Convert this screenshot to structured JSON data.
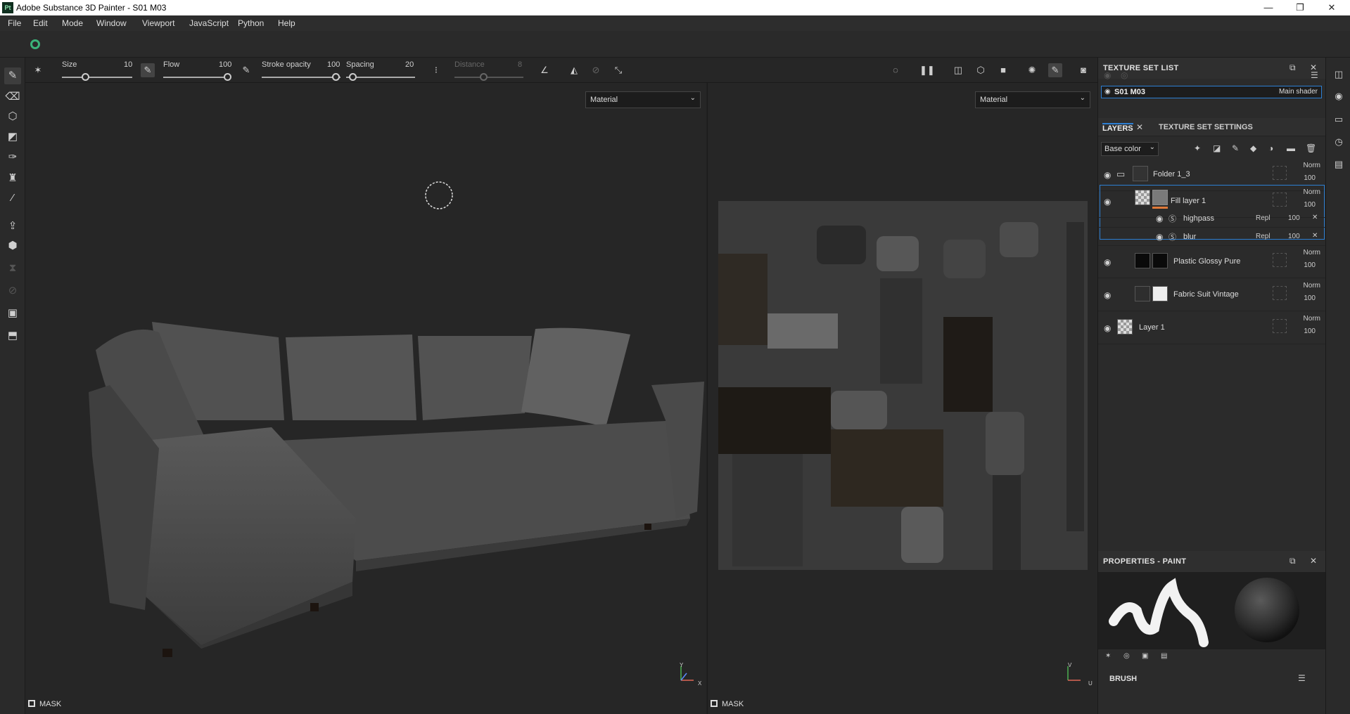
{
  "window": {
    "app_icon": "Pt",
    "title": "Adobe Substance 3D Painter - S01 M03",
    "buttons": [
      "—",
      "❐",
      "✕"
    ]
  },
  "menu": [
    "File",
    "Edit",
    "Mode",
    "Window",
    "Viewport",
    "JavaScript",
    "Python",
    "Help"
  ],
  "toolbar": {
    "size_label": "Size",
    "size_value": "10",
    "flow_label": "Flow",
    "flow_value": "100",
    "stroke_opacity_label": "Stroke opacity",
    "stroke_opacity_value": "100",
    "spacing_label": "Spacing",
    "spacing_value": "20",
    "distance_label": "Distance",
    "distance_value": "8"
  },
  "viewport3d": {
    "material_select": "Material",
    "mask_label": "MASK",
    "axis_y": "Y",
    "axis_x": "X"
  },
  "viewport2d": {
    "material_select": "Material",
    "mask_label": "MASK",
    "axis_v": "V",
    "axis_u": "U"
  },
  "texture_set_list": {
    "title": "TEXTURE SET LIST",
    "item_name": "S01 M03",
    "item_shader": "Main shader"
  },
  "layers_panel": {
    "tabs": [
      "LAYERS",
      "TEXTURE SET SETTINGS"
    ],
    "channel_select": "Base color",
    "layers": [
      {
        "name": "Folder 1_3",
        "blend": "Norm",
        "opacity": "100"
      },
      {
        "name": "Fill layer 1",
        "blend": "Norm",
        "opacity": "100"
      },
      {
        "name": "highpass",
        "blend": "Repl",
        "opacity": "100"
      },
      {
        "name": "blur",
        "blend": "Repl",
        "opacity": "100"
      },
      {
        "name": "Plastic Glossy Pure",
        "blend": "Norm",
        "opacity": "100"
      },
      {
        "name": "Fabric Suit Vintage",
        "blend": "Norm",
        "opacity": "100"
      },
      {
        "name": "Layer 1",
        "blend": "Norm",
        "opacity": "100"
      }
    ]
  },
  "properties": {
    "title": "PROPERTIES - PAINT",
    "brush_label": "BRUSH"
  },
  "colors": {
    "accent": "#2d7fd3",
    "app_green": "#3bb37a",
    "panel_bg": "#2b2b2b",
    "viewport_bg": "#262626"
  }
}
